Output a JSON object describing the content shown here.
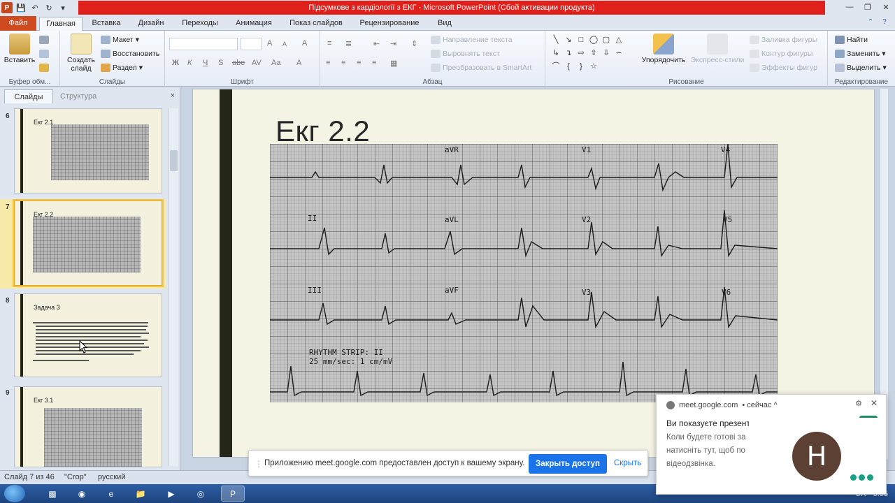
{
  "window": {
    "title": "Підсумкове з кардіології з ЕКГ  -  Microsoft PowerPoint (Сбой активации продукта)"
  },
  "tabs": {
    "file": "Файл",
    "items": [
      "Главная",
      "Вставка",
      "Дизайн",
      "Переходы",
      "Анимация",
      "Показ слайдов",
      "Рецензирование",
      "Вид"
    ]
  },
  "ribbon": {
    "clipboard": {
      "paste": "Вставить",
      "label": "Буфер обм..."
    },
    "slides": {
      "new_slide_line1": "Создать",
      "new_slide_line2": "слайд",
      "layout": "Макет",
      "reset": "Восстановить",
      "section": "Раздел",
      "label": "Слайды"
    },
    "font": {
      "label": "Шрифт",
      "bold": "Ж",
      "italic": "К",
      "underline": "Ч",
      "strike": "S",
      "shadow": "abe",
      "spacing": "AV",
      "case": "Aa",
      "grow": "A",
      "shrink": "A",
      "clear": "A"
    },
    "paragraph": {
      "label": "Абзац",
      "text_direction": "Направление текста",
      "align_text": "Выровнять текст",
      "smartart": "Преобразовать в SmartArt"
    },
    "drawing": {
      "label": "Рисование",
      "arrange": "Упорядочить",
      "quick_styles": "Экспресс-стили",
      "shape_fill": "Заливка фигуры",
      "shape_outline": "Контур фигуры",
      "shape_effects": "Эффекты фигур"
    },
    "editing": {
      "label": "Редактирование",
      "find": "Найти",
      "replace": "Заменить",
      "select": "Выделить"
    }
  },
  "left_panel": {
    "tab_slides": "Слайды",
    "tab_outline": "Структура",
    "close": "×",
    "thumbnails": [
      {
        "number": "6",
        "title": "Екг 2.1"
      },
      {
        "number": "7",
        "title": "Екг 2.2"
      },
      {
        "number": "8",
        "title": "Задача 3"
      },
      {
        "number": "9",
        "title": "Екг 3.1"
      }
    ]
  },
  "slide": {
    "title": "Екг 2.2",
    "ecg_labels": {
      "aVR": "aVR",
      "V1": "V1",
      "V4": "V4",
      "II": "II",
      "aVL": "aVL",
      "V2": "V2",
      "V5": "V5",
      "III": "III",
      "aVF": "aVF",
      "V3": "V3",
      "V6": "V6",
      "rhythm_line1": "RHYTHM STRIP: II",
      "rhythm_line2": "25 mm/sec: 1 cm/mV"
    }
  },
  "status_bar": {
    "slide_count": "Слайд 7 из 46",
    "theme": "\"Croр\"",
    "language": "русский"
  },
  "share_bar": {
    "message": "Приложению meet.google.com предоставлен доступ к вашему экрану.",
    "stop_button": "Закрыть доступ",
    "hide_button": "Скрыть"
  },
  "notification": {
    "source": "meet.google.com",
    "time": "• сейчас ^",
    "title": "Ви показуєте презент",
    "body": "Коли будете готові за натисніть тут, щоб по відеодзвінка."
  },
  "participant": {
    "initial": "H"
  },
  "taskbar": {
    "language": "UK",
    "time": "8:55"
  },
  "colors": {
    "title_red": "#e0201b",
    "file_tab": "#d04a1f",
    "slide_bg": "#f5f3e3",
    "slide_bar": "#242617",
    "meet_blue": "#1a73e8",
    "avatar": "#5c4033",
    "dots": "#1aa184"
  }
}
